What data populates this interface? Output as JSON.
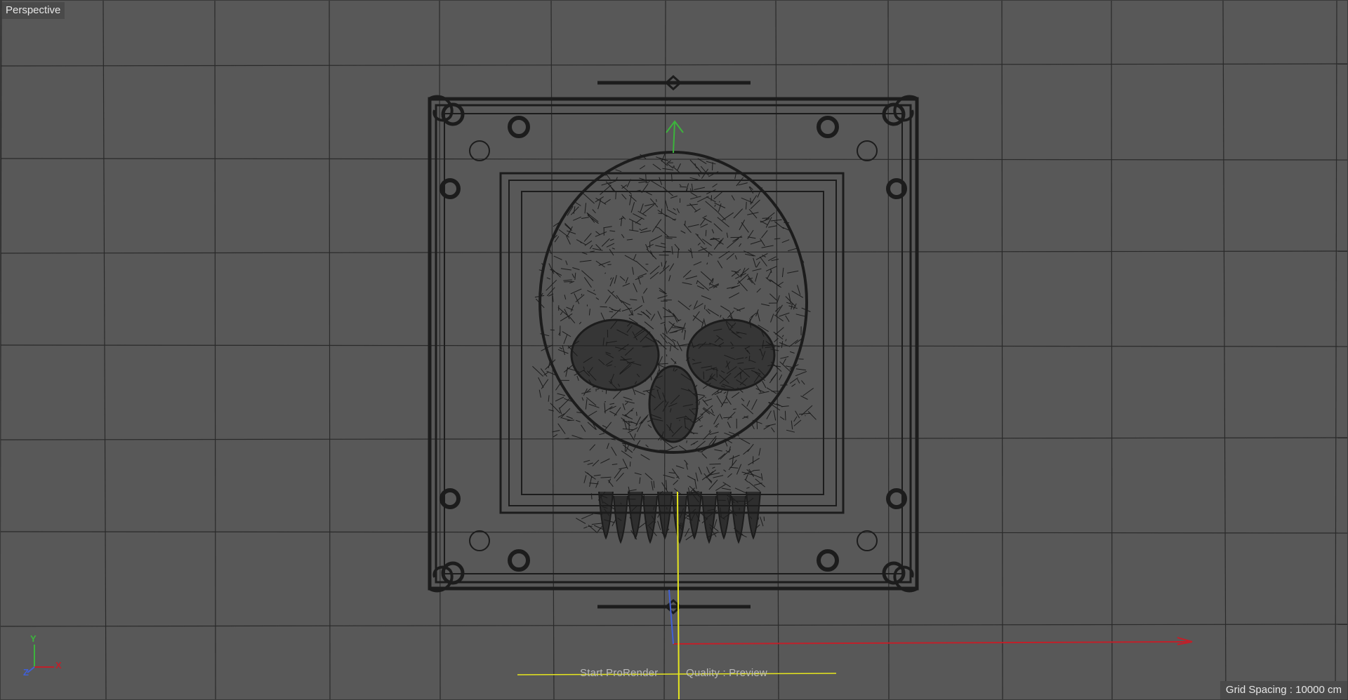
{
  "viewport": {
    "view_name": "Perspective",
    "grid_spacing": "Grid Spacing : 10000 cm"
  },
  "prorender": {
    "start_label": "Start ProRender",
    "quality_label": "Quality : Preview"
  },
  "axes_gizmo": {
    "y": "Y",
    "x": "X",
    "z": "Z"
  },
  "colors": {
    "background": "#585858",
    "grid": "#2a2a2a",
    "wireframe": "#1c1c1c",
    "axis_x": "#c0202a",
    "axis_y": "#3cb43c",
    "axis_z": "#4060d8",
    "prorender_guide": "#e6e61e"
  },
  "objects": [
    {
      "name": "Skull",
      "display": "wireframe"
    },
    {
      "name": "Ornate Frame",
      "display": "wireframe"
    }
  ]
}
